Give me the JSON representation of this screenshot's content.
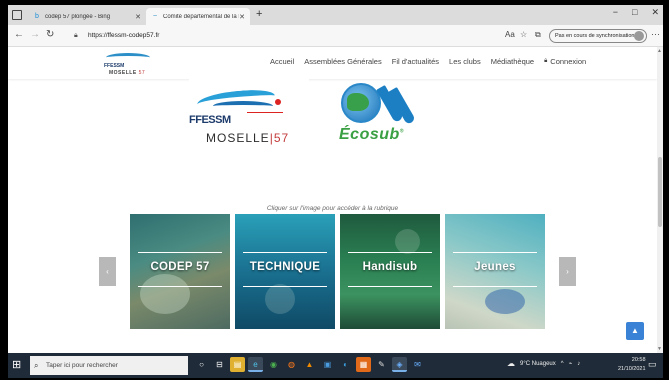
{
  "browser": {
    "tabs": [
      {
        "title": "codep 57 plongée - Bing",
        "favicon": "bing-icon",
        "active": false
      },
      {
        "title": "Comité départemental de la Mo:",
        "favicon": "site-icon",
        "active": true
      }
    ],
    "new_tab": "+",
    "window_controls": {
      "minimize": "−",
      "maximize": "□",
      "close": "✕"
    },
    "nav": {
      "back": "←",
      "forward": "→",
      "reload": "↻",
      "home": "⌂"
    },
    "url": "https://ffessm-codep57.fr",
    "sync_label": "Pas en cours de synchronisation",
    "more": "···"
  },
  "site": {
    "logo": {
      "wave_text": "FFESSM",
      "moselle": "MOSELLE",
      "num": "57"
    },
    "menu": [
      "Accueil",
      "Assemblées Générales",
      "Fil d'actualités",
      "Les clubs",
      "Médiathèque"
    ],
    "login": "Connexion",
    "hero_ffessm": {
      "ff": "FFESSM",
      "moselle": "MOSELLE",
      "sep": "|",
      "num": "57"
    },
    "hero_ecosub": {
      "label": "Écosub",
      "reg": "®"
    },
    "caption": "Cliquer sur l'image pour accéder à la rubrique",
    "cards": [
      {
        "title": "CODEP 57"
      },
      {
        "title": "TECHNIQUE"
      },
      {
        "title": "Handisub"
      },
      {
        "title": "Jeunes"
      }
    ],
    "arrow_left": "‹",
    "arrow_right": "›",
    "to_top": "▲"
  },
  "taskbar": {
    "search_placeholder": "Taper ici pour rechercher",
    "weather": "9°C Nuageux",
    "time": "20:58",
    "date": "21/10/2021",
    "icons": [
      "task-view-icon",
      "explorer-icon",
      "files-icon",
      "edge-icon",
      "chrome-icon",
      "firefox-icon",
      "vlc-icon",
      "store-icon",
      "photos-icon",
      "notes-icon",
      "maps-icon",
      "paint-icon",
      "mail-icon"
    ]
  }
}
